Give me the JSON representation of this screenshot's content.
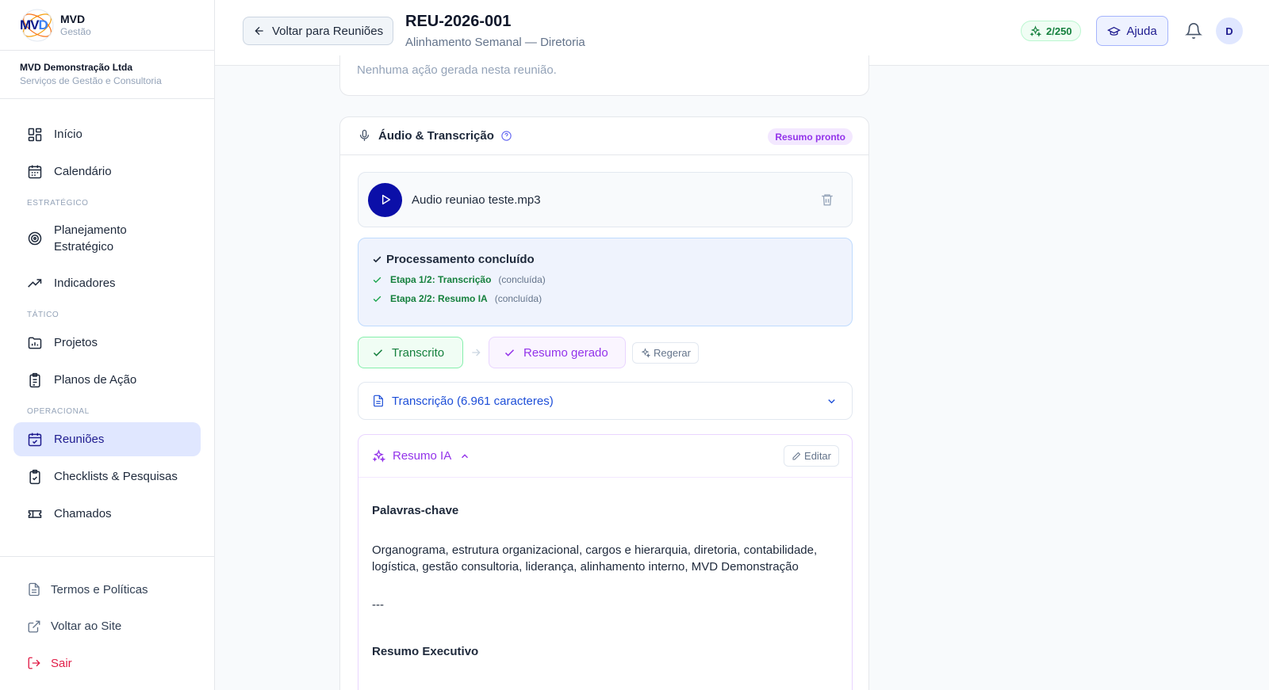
{
  "brand": {
    "logo_text": "MVD",
    "name": "MVD",
    "tagline": "Gestão"
  },
  "org": {
    "name": "MVD Demonstração Ltda",
    "subtitle": "Serviços de Gestão e Consultoria"
  },
  "nav": {
    "inicio": "Início",
    "calendario": "Calendário",
    "section_estrategico": "ESTRATÉGICO",
    "planejamento_1": "Planejamento",
    "planejamento_2": "Estratégico",
    "indicadores": "Indicadores",
    "section_tatico": "TÁTICO",
    "projetos": "Projetos",
    "planos": "Planos de Ação",
    "section_operacional": "OPERACIONAL",
    "reunioes": "Reuniões",
    "checklists": "Checklists & Pesquisas",
    "chamados": "Chamados"
  },
  "footer": {
    "termos": "Termos e Políticas",
    "voltar_site": "Voltar ao Site",
    "sair": "Sair"
  },
  "header": {
    "back_label": "Voltar para Reuniões",
    "title": "REU-2026-001",
    "subtitle": "Alinhamento Semanal — Diretoria",
    "credits": "2/250",
    "help_label": "Ajuda",
    "avatar_initial": "D"
  },
  "actions_card": {
    "empty_text": "Nenhuma ação gerada nesta reunião."
  },
  "audio": {
    "title": "Áudio & Transcrição",
    "status_badge": "Resumo pronto",
    "file_name": "Audio reuniao teste.mp3",
    "processing_title": "Processamento concluído",
    "steps": [
      {
        "label": "Etapa 1/2: Transcrição",
        "status": "(concluída)"
      },
      {
        "label": "Etapa 2/2: Resumo IA",
        "status": "(concluída)"
      }
    ],
    "pill_transcrito": "Transcrito",
    "pill_resumo": "Resumo gerado",
    "regen_label": "Regerar",
    "transcription_label": "Transcrição (6.961 caracteres)"
  },
  "summary": {
    "title": "Resumo IA",
    "edit_label": "Editar",
    "keywords_heading": "Palavras-chave",
    "keywords_text": "Organograma, estrutura organizacional, cargos e hierarquia, diretoria, contabilidade, logística, gestão consultoria, liderança, alinhamento interno, MVD Demonstração",
    "separator": "---",
    "exec_heading": "Resumo Executivo"
  },
  "colors": {
    "primary": "#0b0fa8",
    "active_bg": "#e0e7ff",
    "success": "#15803d",
    "ai_purple": "#9333ea",
    "link_blue": "#1d4ed8",
    "danger": "#e11d48"
  }
}
